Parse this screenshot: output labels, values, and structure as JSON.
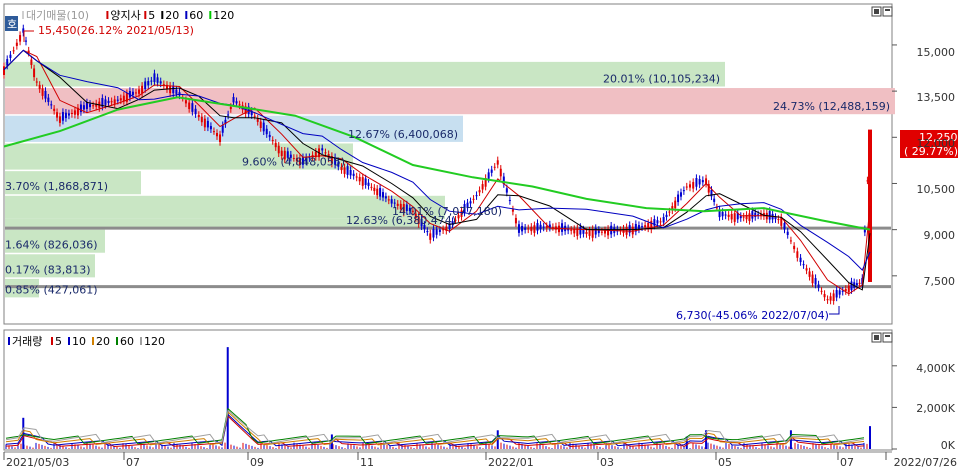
{
  "price_panel": {
    "badge": "호",
    "legend": [
      {
        "label": "대기매물(10)",
        "color": "#9a9a9a",
        "swatch": "#cfcfcf"
      },
      {
        "label": "양지사",
        "color": "#000000",
        "swatch": "#d00000"
      },
      {
        "label": "5",
        "color": "#000000",
        "swatch": "#d00000"
      },
      {
        "label": "20",
        "color": "#000000",
        "swatch": "#000000"
      },
      {
        "label": "60",
        "color": "#000000",
        "swatch": "#0000c0"
      },
      {
        "label": "120",
        "color": "#000000",
        "swatch": "#00c800"
      }
    ],
    "high_note": "15,450(26.12% 2021/05/13)",
    "low_note": "6,730(-45.06% 2022/07/04)",
    "current_price": "12,250",
    "current_change": "( 29.77%)",
    "y_ticks": [
      "15,000",
      "13,500",
      "12,000",
      "10,500",
      "9,000",
      "7,500"
    ]
  },
  "volume_panel": {
    "legend": [
      {
        "label": "거래량",
        "swatch": "#0000c0"
      },
      {
        "label": "5",
        "swatch": "#d00000"
      },
      {
        "label": "10",
        "swatch": "#0000c0"
      },
      {
        "label": "20",
        "swatch": "#d08000"
      },
      {
        "label": "60",
        "swatch": "#008000"
      },
      {
        "label": "120",
        "swatch": "#a0a0a0"
      }
    ],
    "y_ticks": [
      "4,000K",
      "2,000K",
      "0K"
    ]
  },
  "x_ticks": [
    "2021/05/03",
    "07",
    "09",
    "11",
    "2022/01",
    "03",
    "05",
    "07",
    "2022/07/26"
  ],
  "chart_data": {
    "type": "candlestick",
    "title": "양지사",
    "x_range": [
      "2021/05/03",
      "2022/07/26"
    ],
    "y_range": [
      6000,
      16200
    ],
    "supply_zones": [
      {
        "price_low": 13650,
        "price_high": 14450,
        "label": "20.01% (10,105,234)",
        "color": "#c9e6c4"
      },
      {
        "price_low": 12750,
        "price_high": 13600,
        "label": "24.73% (12,488,159)",
        "color": "#f0bfc3"
      },
      {
        "price_low": 11850,
        "price_high": 12700,
        "label": "12.67% (6,400,068)",
        "color": "#c7dff0"
      },
      {
        "price_low": 10950,
        "price_high": 11800,
        "label": "9.60% (4,848,055)",
        "color": "#c9e6c4"
      },
      {
        "price_low": 10150,
        "price_high": 10900,
        "label": "3.70% (1,868,871)",
        "color": "#c9e6c4"
      },
      {
        "price_low": 9350,
        "price_high": 10100,
        "label": "14.01% (7,077,180)",
        "color": "#c9e6c4"
      },
      {
        "price_low": 9050,
        "price_high": 9350,
        "label": "12.63% (6,380,474)",
        "color": "#c9e6c4"
      },
      {
        "price_low": 8250,
        "price_high": 9000,
        "label": "1.64% (826,036)",
        "color": "#c9e6c4"
      },
      {
        "price_low": 7450,
        "price_high": 8200,
        "label": "0.17% (83,813)",
        "color": "#c9e6c4"
      },
      {
        "price_low": 6800,
        "price_high": 7400,
        "label": "0.85% (427,061)",
        "color": "#c9e6c4"
      }
    ],
    "horizontal_lines": [
      9050,
      7150
    ],
    "price_series": [
      [
        "2021/05/03",
        14200
      ],
      [
        "2021/05/13",
        15450
      ],
      [
        "2021/05/20",
        13800
      ],
      [
        "2021/06/01",
        12600
      ],
      [
        "2021/06/15",
        13000
      ],
      [
        "2021/07/01",
        13200
      ],
      [
        "2021/07/12",
        13500
      ],
      [
        "2021/07/20",
        13900
      ],
      [
        "2021/08/02",
        13400
      ],
      [
        "2021/08/12",
        12700
      ],
      [
        "2021/08/23",
        12000
      ],
      [
        "2021/08/30",
        13200
      ],
      [
        "2021/09/10",
        12700
      ],
      [
        "2021/09/24",
        11500
      ],
      [
        "2021/10/05",
        11200
      ],
      [
        "2021/10/15",
        11600
      ],
      [
        "2021/10/25",
        11000
      ],
      [
        "2021/11/05",
        10600
      ],
      [
        "2021/11/20",
        9900
      ],
      [
        "2021/12/01",
        9600
      ],
      [
        "2021/12/10",
        8800
      ],
      [
        "2021/12/20",
        9100
      ],
      [
        "2022/01/03",
        10100
      ],
      [
        "2022/01/14",
        11200
      ],
      [
        "2022/01/25",
        9000
      ],
      [
        "2022/02/10",
        9100
      ],
      [
        "2022/03/01",
        8900
      ],
      [
        "2022/03/25",
        9000
      ],
      [
        "2022/04/10",
        9300
      ],
      [
        "2022/04/22",
        10400
      ],
      [
        "2022/05/02",
        10600
      ],
      [
        "2022/05/09",
        9500
      ],
      [
        "2022/05/20",
        9400
      ],
      [
        "2022/06/01",
        9500
      ],
      [
        "2022/06/10",
        9300
      ],
      [
        "2022/06/20",
        8000
      ],
      [
        "2022/07/04",
        6730
      ],
      [
        "2022/07/15",
        7100
      ],
      [
        "2022/07/22",
        7300
      ],
      [
        "2022/07/26",
        12250
      ]
    ],
    "ma120": [
      [
        "2021/05/03",
        11700
      ],
      [
        "2021/06/01",
        12200
      ],
      [
        "2021/07/01",
        12900
      ],
      [
        "2021/08/01",
        13300
      ],
      [
        "2021/09/01",
        13000
      ],
      [
        "2021/10/01",
        12700
      ],
      [
        "2021/11/01",
        12000
      ],
      [
        "2021/12/01",
        11100
      ],
      [
        "2022/01/01",
        10700
      ],
      [
        "2022/02/01",
        10400
      ],
      [
        "2022/03/01",
        10000
      ],
      [
        "2022/04/01",
        9700
      ],
      [
        "2022/05/01",
        9600
      ],
      [
        "2022/06/01",
        9700
      ],
      [
        "2022/07/01",
        9300
      ],
      [
        "2022/07/26",
        9000
      ]
    ],
    "volume_axis": {
      "min": 0,
      "max": 5000,
      "unit": "K"
    },
    "volume_spikes": [
      [
        "2021/05/13",
        1500
      ],
      [
        "2021/08/27",
        4900
      ],
      [
        "2021/10/20",
        700
      ],
      [
        "2022/01/14",
        900
      ],
      [
        "2022/04/22",
        600
      ],
      [
        "2022/05/02",
        900
      ],
      [
        "2022/06/15",
        900
      ],
      [
        "2022/07/26",
        1100
      ]
    ]
  }
}
